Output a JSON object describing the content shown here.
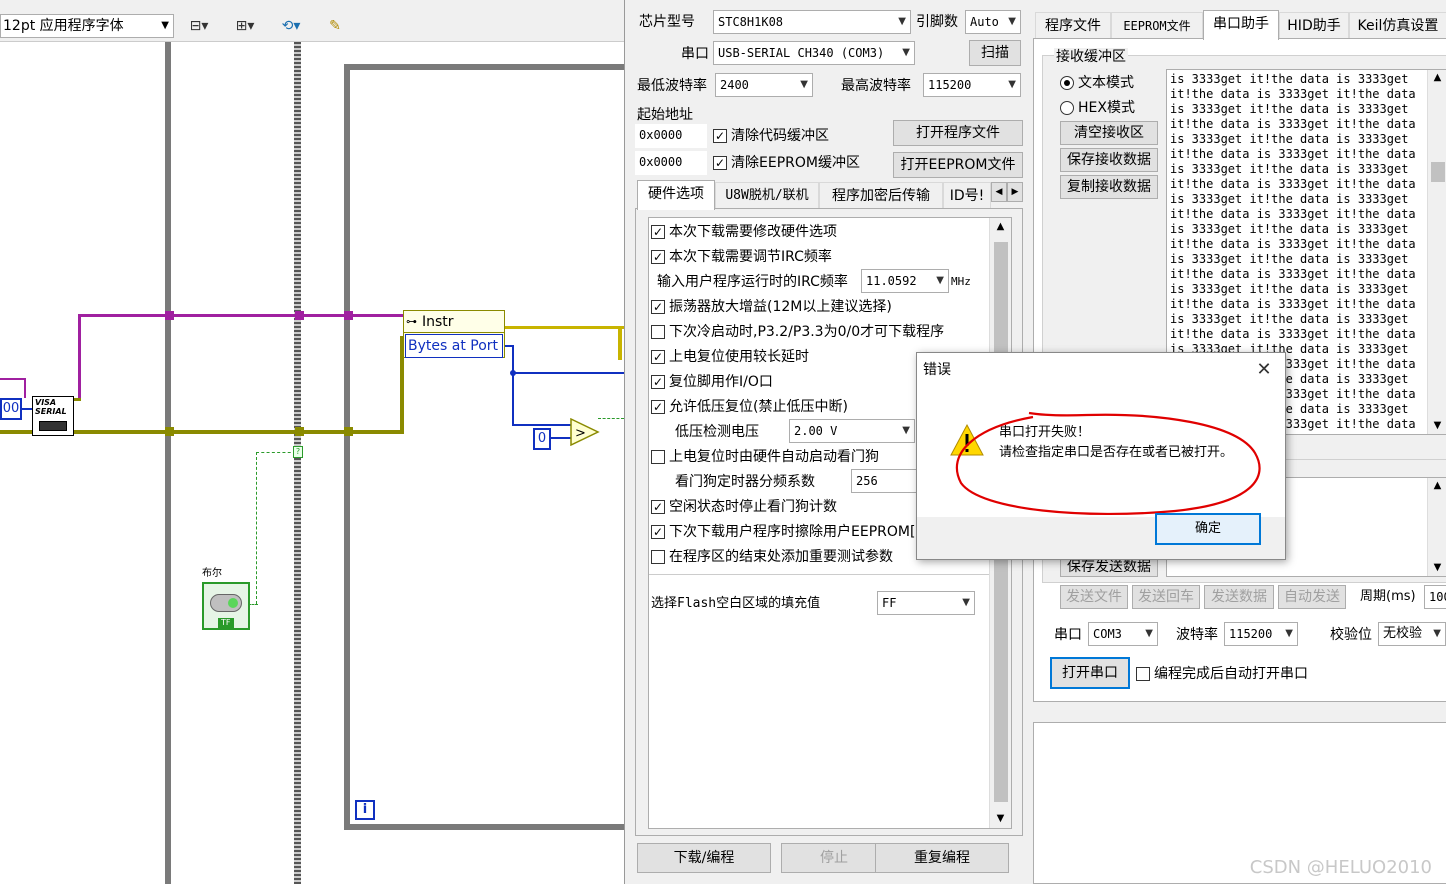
{
  "labview": {
    "font_selector": "12pt 应用程序字体",
    "nodes": {
      "visa_serial_label": "VISA SERIAL",
      "instr_label": "Instr",
      "bytes_at_port_label": "Bytes at Port",
      "zero_constant": "0",
      "left_constant": "00",
      "bool_caption": "布尔",
      "bool_tf": "TF",
      "loop_info": "i"
    }
  },
  "stc": {
    "chip_type_label": "芯片型号",
    "chip_type_value": "STC8H1K08",
    "pin_count_label": "引脚数",
    "pin_count_value": "Auto",
    "port_label": "串口",
    "port_value": "USB-SERIAL CH340 (COM3)",
    "scan_button": "扫描",
    "min_baud_label": "最低波特率",
    "min_baud_value": "2400",
    "max_baud_label": "最高波特率",
    "max_baud_value": "115200",
    "start_addr_label": "起始地址",
    "addr1_value": "0x0000",
    "addr2_value": "0x0000",
    "clear_code_label": "清除代码缓冲区",
    "clear_eeprom_label": "清除EEPROM缓冲区",
    "open_program_button": "打开程序文件",
    "open_eeprom_button": "打开EEPROM文件",
    "hw_tabs": [
      {
        "label": "硬件选项"
      },
      {
        "label": "U8W脱机/联机"
      },
      {
        "label": "程序加密后传输"
      },
      {
        "label": "ID号!"
      }
    ],
    "hw_options": {
      "opt1": "本次下载需要修改硬件选项",
      "opt2": "本次下载需要调节IRC频率",
      "irc_label": "输入用户程序运行时的IRC频率",
      "irc_value": "11.0592",
      "irc_unit": "MHz",
      "opt3": "振荡器放大增益(12M以上建议选择)",
      "opt4": "下次冷启动时,P3.2/P3.3为0/0才可下载程序",
      "opt5": "上电复位使用较长延时",
      "opt6": "复位脚用作I/O口",
      "opt7": "允许低压复位(禁止低压中断)",
      "lvd_label": "低压检测电压",
      "lvd_value": "2.00 V",
      "opt8": "上电复位时由硬件自动启动看门狗",
      "wdt_label": "看门狗定时器分频系数",
      "wdt_value": "256",
      "opt9": "空闲状态时停止看门狗计数",
      "opt10": "下次下载用户程序时擦除用户EEPROM[",
      "opt11": "在程序区的结束处添加重要测试参数",
      "fill_label": "选择Flash空白区域的填充值",
      "fill_value": "FF"
    },
    "download_button": "下载/编程",
    "stop_button": "停止",
    "reprogram_button": "重复编程",
    "main_tabs": [
      {
        "label": "程序文件"
      },
      {
        "label": "EEPROM文件"
      },
      {
        "label": "串口助手"
      },
      {
        "label": "HID助手"
      },
      {
        "label": "Keil仿真设置"
      }
    ],
    "serial": {
      "recv_group": "接收缓冲区",
      "text_mode": "文本模式",
      "hex_mode": "HEX模式",
      "clear_recv": "清空接收区",
      "save_recv": "保存接收数据",
      "copy_recv": "复制接收数据",
      "recv_lines": [
        "is 3333get it!the data is 3333get",
        "it!the data is 3333get it!the data",
        "is 3333get it!the data is 3333get",
        "it!the data is 3333get it!the data",
        "is 3333get it!the data is 3333get",
        "it!the data is 3333get it!the data",
        "is 3333get it!the data is 3333get",
        "it!the data is 3333get it!the data",
        "is 3333get it!the data is 3333get",
        "it!the data is 3333get it!the data",
        "is 3333get it!the data is 3333get",
        "it!the data is 3333get it!the data",
        "is 3333get it!the data is 3333get",
        "it!the data is 3333get it!the data",
        "is 3333get it!the data is 3333get",
        "it!the data is 3333get it!the data",
        "is 3333get it!the data is 3333get",
        "it!the data is 3333get it!the data",
        "is 3333get it!the data is 3333get",
        "it!the data is 3333get it!the data",
        "is 3333get it!the data is 3333get",
        "it!the data is 3333get it!the data",
        "is 3333get it!the data is 3333get",
        "it!the data is 3333get it!the data"
      ],
      "save_send": "保存发送数据",
      "send_file": "发送文件",
      "send_back": "发送回车",
      "send_data": "发送数据",
      "auto_send": "自动发送",
      "period_label": "周期(ms)",
      "period_value": "100",
      "port_label": "串口",
      "port_value": "COM3",
      "baud_label": "波特率",
      "baud_value": "115200",
      "parity_label": "校验位",
      "parity_value": "无校验",
      "open_port": "打开串口",
      "auto_open_label": "编程完成后自动打开串口"
    }
  },
  "dialog": {
    "title": "错误",
    "line1": "串口打开失败！",
    "line2": "请检查指定串口是否存在或者已被打开。",
    "ok_button": "确定",
    "annotation_color": "#e00000"
  },
  "watermark": "CSDN @HELUO2010"
}
